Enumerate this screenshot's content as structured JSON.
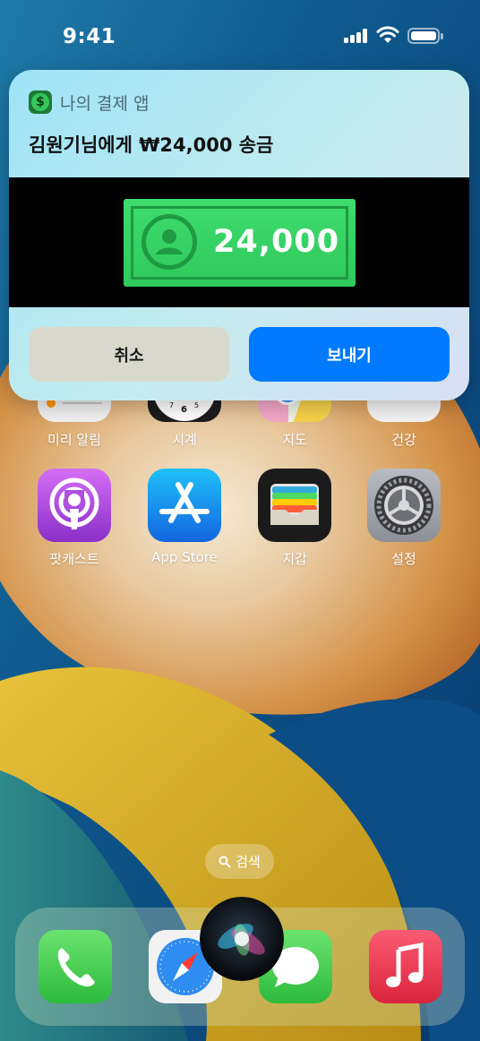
{
  "status_bar": {
    "time": "9:41"
  },
  "notification": {
    "app_name": "나의 결제 앱",
    "title": "김원기님에게 ₩24,000 송금",
    "bill_amount": "24,000",
    "cancel_label": "취소",
    "send_label": "보내기",
    "accent_color": "#007aff"
  },
  "apps_row1": [
    {
      "label": "미리 알림",
      "icon": "reminders-icon"
    },
    {
      "label": "시계",
      "icon": "clock-icon"
    },
    {
      "label": "지도",
      "icon": "maps-icon"
    },
    {
      "label": "건강",
      "icon": "health-icon"
    }
  ],
  "apps_row2": [
    {
      "label": "팟캐스트",
      "icon": "podcasts-icon"
    },
    {
      "label": "App Store",
      "icon": "app-store-icon"
    },
    {
      "label": "지갑",
      "icon": "wallet-icon"
    },
    {
      "label": "설정",
      "icon": "settings-icon"
    }
  ],
  "search": {
    "label": "검색"
  },
  "dock": [
    "phone-icon",
    "safari-icon",
    "messages-icon",
    "music-icon"
  ]
}
